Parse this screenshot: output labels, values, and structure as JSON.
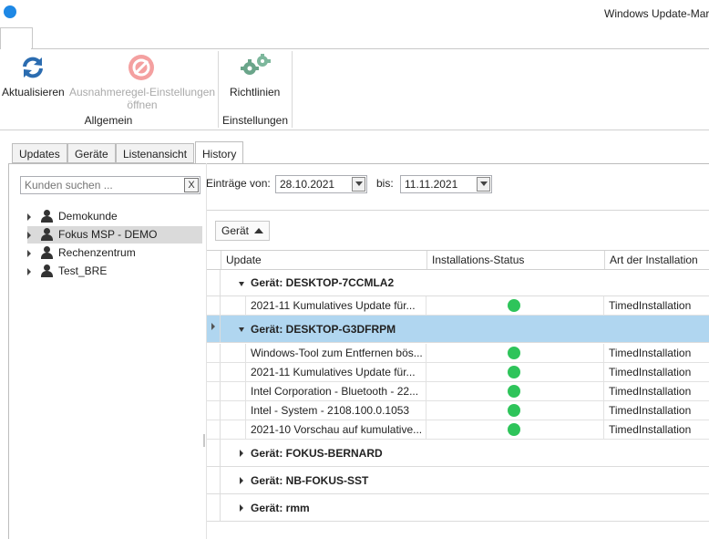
{
  "window": {
    "title": "Windows Update-Mar"
  },
  "ribbon": {
    "buttons": {
      "refresh": "Aktualisieren",
      "exception_line1": "Ausnahmeregel-Einstellungen",
      "exception_line2": "öffnen",
      "policies": "Richtlinien"
    },
    "groups": {
      "general": "Allgemein",
      "settings": "Einstellungen"
    }
  },
  "tabs": [
    "Updates",
    "Geräte",
    "Listenansicht",
    "History"
  ],
  "search": {
    "placeholder": "Kunden suchen ...",
    "clear": "X"
  },
  "tree": [
    "Demokunde",
    "Fokus MSP - DEMO",
    "Rechenzentrum",
    "Test_BRE"
  ],
  "filter": {
    "from_label": "Einträge von:",
    "from_value": "28.10.2021",
    "to_label": "bis:",
    "to_value": "11.11.2021"
  },
  "grid": {
    "group_chip": "Gerät",
    "columns": [
      "Update",
      "Installations-Status",
      "Art der Installation"
    ],
    "groups": [
      {
        "label": "Gerät: DESKTOP-7CCMLA2",
        "rows": [
          {
            "update": "2021-11 Kumulatives Update für...",
            "art": "TimedInstallation"
          }
        ]
      },
      {
        "label": "Gerät: DESKTOP-G3DFRPM",
        "rows": [
          {
            "update": "Windows-Tool zum Entfernen bös...",
            "art": "TimedInstallation"
          },
          {
            "update": "2021-11 Kumulatives Update für...",
            "art": "TimedInstallation"
          },
          {
            "update": "Intel Corporation - Bluetooth - 22...",
            "art": "TimedInstallation"
          },
          {
            "update": "Intel - System - 2108.100.0.1053",
            "art": "TimedInstallation"
          },
          {
            "update": "2021-10 Vorschau auf kumulative...",
            "art": "TimedInstallation"
          }
        ]
      },
      {
        "label": "Gerät: FOKUS-BERNARD"
      },
      {
        "label": "Gerät: NB-FOKUS-SST"
      },
      {
        "label": "Gerät: rmm"
      }
    ]
  },
  "colors": {
    "selected_row": "#b0d6f0",
    "status_ok": "#2ec45a",
    "accent": "#1e88e5"
  }
}
